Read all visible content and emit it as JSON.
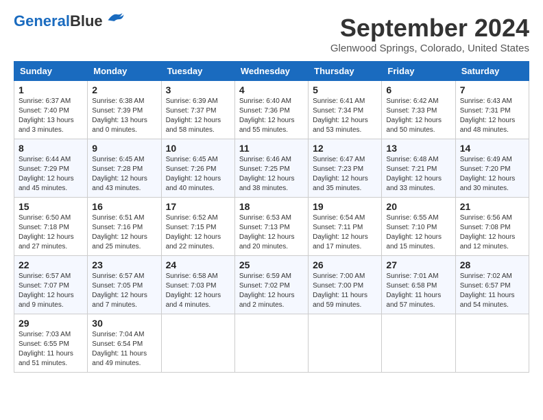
{
  "logo": {
    "text1": "General",
    "text2": "Blue"
  },
  "title": "September 2024",
  "location": "Glenwood Springs, Colorado, United States",
  "days_of_week": [
    "Sunday",
    "Monday",
    "Tuesday",
    "Wednesday",
    "Thursday",
    "Friday",
    "Saturday"
  ],
  "weeks": [
    [
      {
        "day": "1",
        "sunrise": "6:37 AM",
        "sunset": "7:40 PM",
        "daylight": "13 hours and 3 minutes."
      },
      {
        "day": "2",
        "sunrise": "6:38 AM",
        "sunset": "7:39 PM",
        "daylight": "13 hours and 0 minutes."
      },
      {
        "day": "3",
        "sunrise": "6:39 AM",
        "sunset": "7:37 PM",
        "daylight": "12 hours and 58 minutes."
      },
      {
        "day": "4",
        "sunrise": "6:40 AM",
        "sunset": "7:36 PM",
        "daylight": "12 hours and 55 minutes."
      },
      {
        "day": "5",
        "sunrise": "6:41 AM",
        "sunset": "7:34 PM",
        "daylight": "12 hours and 53 minutes."
      },
      {
        "day": "6",
        "sunrise": "6:42 AM",
        "sunset": "7:33 PM",
        "daylight": "12 hours and 50 minutes."
      },
      {
        "day": "7",
        "sunrise": "6:43 AM",
        "sunset": "7:31 PM",
        "daylight": "12 hours and 48 minutes."
      }
    ],
    [
      {
        "day": "8",
        "sunrise": "6:44 AM",
        "sunset": "7:29 PM",
        "daylight": "12 hours and 45 minutes."
      },
      {
        "day": "9",
        "sunrise": "6:45 AM",
        "sunset": "7:28 PM",
        "daylight": "12 hours and 43 minutes."
      },
      {
        "day": "10",
        "sunrise": "6:45 AM",
        "sunset": "7:26 PM",
        "daylight": "12 hours and 40 minutes."
      },
      {
        "day": "11",
        "sunrise": "6:46 AM",
        "sunset": "7:25 PM",
        "daylight": "12 hours and 38 minutes."
      },
      {
        "day": "12",
        "sunrise": "6:47 AM",
        "sunset": "7:23 PM",
        "daylight": "12 hours and 35 minutes."
      },
      {
        "day": "13",
        "sunrise": "6:48 AM",
        "sunset": "7:21 PM",
        "daylight": "12 hours and 33 minutes."
      },
      {
        "day": "14",
        "sunrise": "6:49 AM",
        "sunset": "7:20 PM",
        "daylight": "12 hours and 30 minutes."
      }
    ],
    [
      {
        "day": "15",
        "sunrise": "6:50 AM",
        "sunset": "7:18 PM",
        "daylight": "12 hours and 27 minutes."
      },
      {
        "day": "16",
        "sunrise": "6:51 AM",
        "sunset": "7:16 PM",
        "daylight": "12 hours and 25 minutes."
      },
      {
        "day": "17",
        "sunrise": "6:52 AM",
        "sunset": "7:15 PM",
        "daylight": "12 hours and 22 minutes."
      },
      {
        "day": "18",
        "sunrise": "6:53 AM",
        "sunset": "7:13 PM",
        "daylight": "12 hours and 20 minutes."
      },
      {
        "day": "19",
        "sunrise": "6:54 AM",
        "sunset": "7:11 PM",
        "daylight": "12 hours and 17 minutes."
      },
      {
        "day": "20",
        "sunrise": "6:55 AM",
        "sunset": "7:10 PM",
        "daylight": "12 hours and 15 minutes."
      },
      {
        "day": "21",
        "sunrise": "6:56 AM",
        "sunset": "7:08 PM",
        "daylight": "12 hours and 12 minutes."
      }
    ],
    [
      {
        "day": "22",
        "sunrise": "6:57 AM",
        "sunset": "7:07 PM",
        "daylight": "12 hours and 9 minutes."
      },
      {
        "day": "23",
        "sunrise": "6:57 AM",
        "sunset": "7:05 PM",
        "daylight": "12 hours and 7 minutes."
      },
      {
        "day": "24",
        "sunrise": "6:58 AM",
        "sunset": "7:03 PM",
        "daylight": "12 hours and 4 minutes."
      },
      {
        "day": "25",
        "sunrise": "6:59 AM",
        "sunset": "7:02 PM",
        "daylight": "12 hours and 2 minutes."
      },
      {
        "day": "26",
        "sunrise": "7:00 AM",
        "sunset": "7:00 PM",
        "daylight": "11 hours and 59 minutes."
      },
      {
        "day": "27",
        "sunrise": "7:01 AM",
        "sunset": "6:58 PM",
        "daylight": "11 hours and 57 minutes."
      },
      {
        "day": "28",
        "sunrise": "7:02 AM",
        "sunset": "6:57 PM",
        "daylight": "11 hours and 54 minutes."
      }
    ],
    [
      {
        "day": "29",
        "sunrise": "7:03 AM",
        "sunset": "6:55 PM",
        "daylight": "11 hours and 51 minutes."
      },
      {
        "day": "30",
        "sunrise": "7:04 AM",
        "sunset": "6:54 PM",
        "daylight": "11 hours and 49 minutes."
      },
      null,
      null,
      null,
      null,
      null
    ]
  ]
}
